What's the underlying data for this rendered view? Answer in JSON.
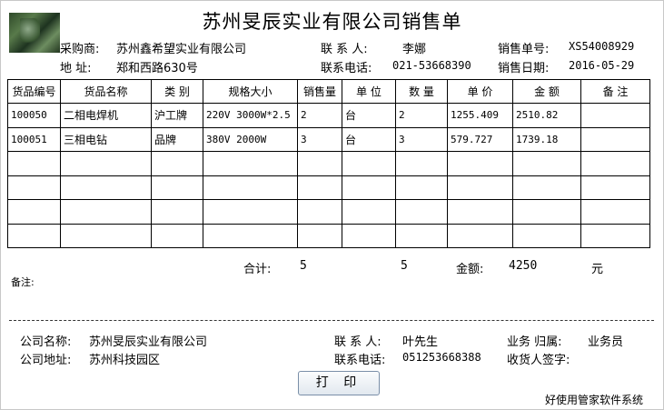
{
  "title": "苏州旻辰实业有限公司销售单",
  "header": {
    "buyer_label": "采购商:",
    "buyer": "苏州鑫希望实业有限公司",
    "address_label": "地   址:",
    "address": "郑和西路630号",
    "contact_label": "联 系 人:",
    "contact": "李娜",
    "phone_label": "联系电话:",
    "phone": "021-53668390",
    "order_no_label": "销售单号:",
    "order_no": "XS54008929",
    "date_label": "销售日期:",
    "date": "2016-05-29"
  },
  "table": {
    "columns": [
      "货品编号",
      "货品名称",
      "类 别",
      "规格大小",
      "销售量",
      "单 位",
      "数 量",
      "单 价",
      "金 额",
      "备 注"
    ],
    "rows": [
      [
        "100050",
        "二相电焊机",
        "沪工牌",
        "220V 3000W*2.5",
        "2",
        "台",
        "2",
        "1255.409",
        "2510.82",
        ""
      ],
      [
        "100051",
        "三相电钻",
        "品牌",
        "380V 2000W",
        "3",
        "台",
        "3",
        "579.727",
        "1739.18",
        ""
      ],
      [
        "",
        "",
        "",
        "",
        "",
        "",
        "",
        "",
        "",
        ""
      ],
      [
        "",
        "",
        "",
        "",
        "",
        "",
        "",
        "",
        "",
        ""
      ],
      [
        "",
        "",
        "",
        "",
        "",
        "",
        "",
        "",
        "",
        ""
      ],
      [
        "",
        "",
        "",
        "",
        "",
        "",
        "",
        "",
        "",
        ""
      ]
    ]
  },
  "totals": {
    "label": "合计:",
    "sales_qty": "5",
    "qty": "5",
    "amount_label": "金额:",
    "amount": "4250",
    "currency": "元"
  },
  "remarks_label": "备注:",
  "footer": {
    "company_label": "公司名称:",
    "company": "苏州旻辰实业有限公司",
    "address_label": "公司地址:",
    "address": "苏州科技园区",
    "contact_label": "联 系 人:",
    "contact": "叶先生",
    "phone_label": "联系电话:",
    "phone": "051253668388",
    "owner_label": "业务  归属:",
    "owner": "业务员",
    "sign_label": "收货人签字:"
  },
  "print_button": "打 印",
  "brand_note": "好使用管家软件系统"
}
